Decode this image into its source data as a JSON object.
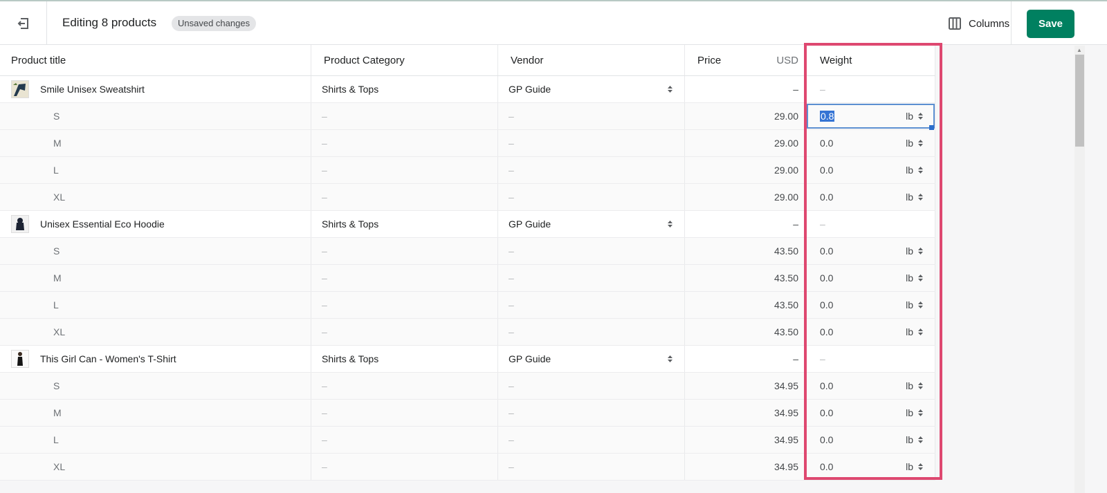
{
  "header": {
    "title": "Editing 8 products",
    "status_badge": "Unsaved changes",
    "columns_label": "Columns",
    "save_label": "Save",
    "exit_icon": "exit-icon",
    "columns_icon": "columns-icon"
  },
  "table": {
    "columns": {
      "title": "Product title",
      "category": "Product Category",
      "vendor": "Vendor",
      "price": "Price",
      "price_currency": "USD",
      "weight": "Weight"
    },
    "empty": "–",
    "unit": "lb",
    "products": [
      {
        "title": "Smile Unisex Sweatshirt",
        "category": "Shirts & Tops",
        "vendor": "GP Guide",
        "variants": [
          {
            "name": "S",
            "price": "29.00",
            "weight": "0.8"
          },
          {
            "name": "M",
            "price": "29.00",
            "weight": "0.0"
          },
          {
            "name": "L",
            "price": "29.00",
            "weight": "0.0"
          },
          {
            "name": "XL",
            "price": "29.00",
            "weight": "0.0"
          }
        ]
      },
      {
        "title": "Unisex Essential Eco Hoodie",
        "category": "Shirts & Tops",
        "vendor": "GP Guide",
        "variants": [
          {
            "name": "S",
            "price": "43.50",
            "weight": "0.0"
          },
          {
            "name": "M",
            "price": "43.50",
            "weight": "0.0"
          },
          {
            "name": "L",
            "price": "43.50",
            "weight": "0.0"
          },
          {
            "name": "XL",
            "price": "43.50",
            "weight": "0.0"
          }
        ]
      },
      {
        "title": "This Girl Can - Women's T-Shirt",
        "category": "Shirts & Tops",
        "vendor": "GP Guide",
        "variants": [
          {
            "name": "S",
            "price": "34.95",
            "weight": "0.0"
          },
          {
            "name": "M",
            "price": "34.95",
            "weight": "0.0"
          },
          {
            "name": "L",
            "price": "34.95",
            "weight": "0.0"
          },
          {
            "name": "XL",
            "price": "34.95",
            "weight": "0.0"
          }
        ]
      }
    ]
  },
  "colors": {
    "accent": "#008060",
    "highlight_frame": "#de4870",
    "selection": "#3574d4"
  }
}
